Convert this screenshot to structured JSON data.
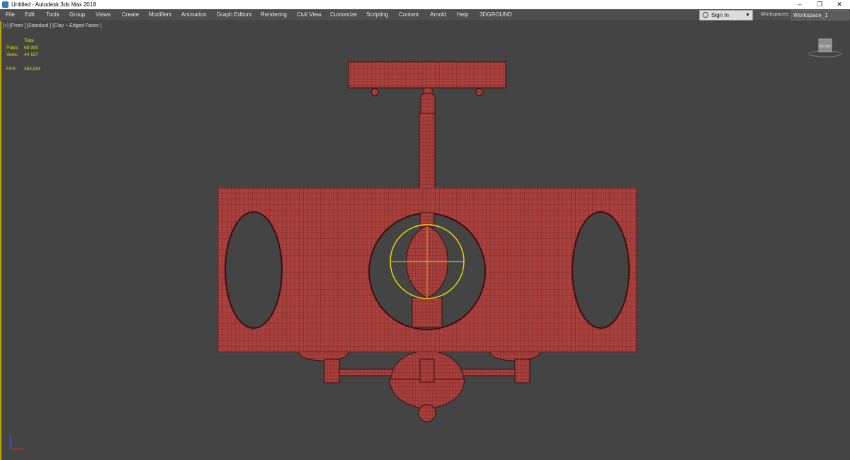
{
  "titlebar": {
    "title": "Untitled - Autodesk 3ds Max 2018",
    "minimize": "–",
    "maximize": "❐",
    "close": "✕"
  },
  "menu": [
    "File",
    "Edit",
    "Tools",
    "Group",
    "Views",
    "Create",
    "Modifiers",
    "Animation",
    "Graph Editors",
    "Rendering",
    "Civil View",
    "Customize",
    "Scripting",
    "Content",
    "Arnold",
    "Help",
    "3DGROUND"
  ],
  "signin": {
    "label": "Sign In",
    "caret": "▼"
  },
  "workspaces": {
    "label": "Workspaces:",
    "value": "Workspace_1"
  },
  "viewport": {
    "label": "[+] [Front ] [Standard ] [Clay + Edged Faces ]",
    "stats": {
      "total_label": "Total",
      "polys_label": "Polys:",
      "polys_value": "68 900",
      "verts_label": "Verts:",
      "verts_value": "44 107",
      "fps_label": "FPS:",
      "fps_value": "363,941"
    },
    "viewcube_label": "FRONT"
  },
  "colors": {
    "mesh": "#a8403d",
    "wire": "#5b1514",
    "selection": "#f0e000",
    "viewport_border": "#b7a400"
  }
}
